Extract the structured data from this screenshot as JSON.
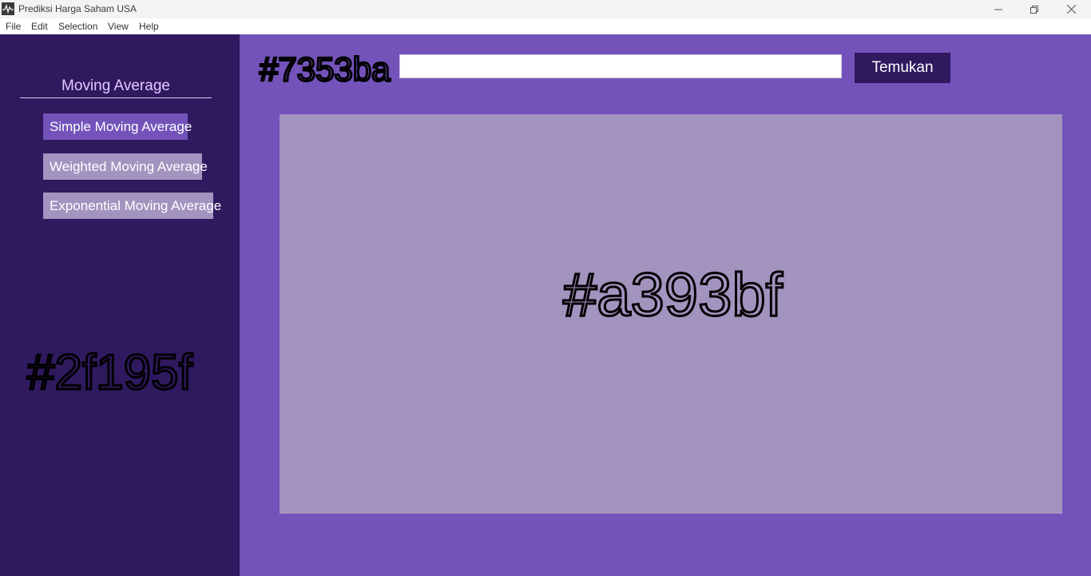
{
  "window": {
    "title": "Prediksi Harga Saham USA",
    "app_icon": "stock-chart-icon",
    "controls": {
      "minimize": "─",
      "maximize": "❐",
      "close": "✕"
    }
  },
  "menu": {
    "items": [
      {
        "label": "File"
      },
      {
        "label": "Edit"
      },
      {
        "label": "Selection"
      },
      {
        "label": "View"
      },
      {
        "label": "Help"
      }
    ]
  },
  "sidebar": {
    "heading": "Moving Average",
    "buttons": [
      {
        "label": "Simple Moving Average",
        "active": true
      },
      {
        "label": "Weighted Moving Average",
        "active": false
      },
      {
        "label": "Exponential Moving Average",
        "active": false
      }
    ],
    "color_label": "#2f195f"
  },
  "main": {
    "color_label": "#7353ba",
    "search": {
      "value": "",
      "placeholder": ""
    },
    "find_button": "Temukan",
    "chart_panel": {
      "color_label": "#a393bf"
    }
  },
  "colors": {
    "sidebar_bg": "#2f195f",
    "main_bg": "#7353ba",
    "panel_bg": "#a393bf",
    "heading_text": "#e4c8ff"
  }
}
